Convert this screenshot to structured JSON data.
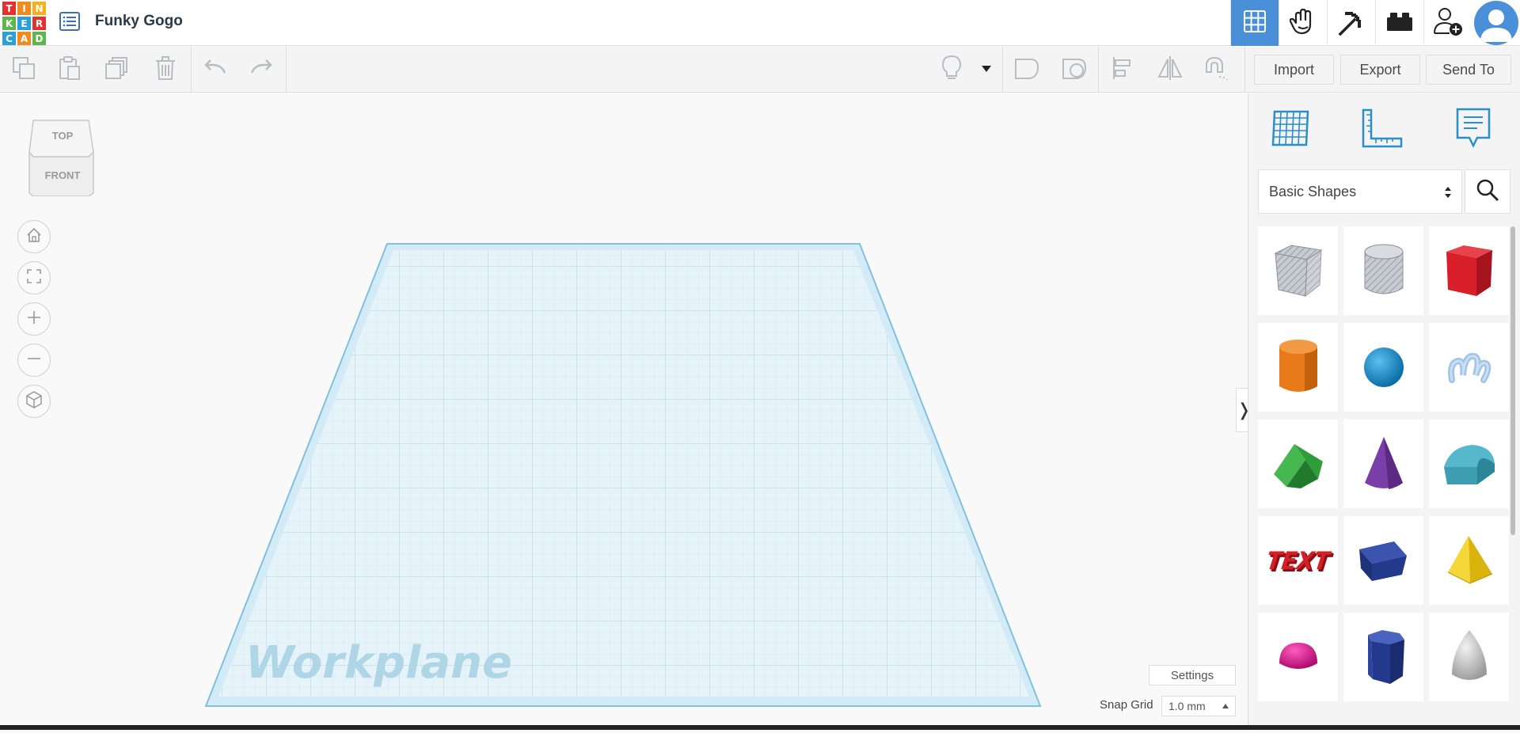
{
  "app": {
    "logo_letters": [
      "T",
      "I",
      "N",
      "K",
      "E",
      "R",
      "C",
      "A",
      "D"
    ],
    "logo_colors": [
      "#e4312b",
      "#f18b21",
      "#f6b019",
      "#5eb74d",
      "#2a9fd8",
      "#e4312b",
      "#2a9fd8",
      "#f18b21",
      "#5eb74d"
    ],
    "document_title": "Funky Gogo"
  },
  "topbar": {
    "buttons": [
      {
        "name": "3d-design-view",
        "icon": "grid-icon",
        "active": true
      },
      {
        "name": "codeblocks",
        "icon": "hand-icon",
        "active": false
      },
      {
        "name": "minecraft",
        "icon": "pickaxe-icon",
        "active": false
      },
      {
        "name": "lego-bricks",
        "icon": "brick-icon",
        "active": false
      },
      {
        "name": "invite",
        "icon": "add-user-icon",
        "active": false
      }
    ]
  },
  "toolbar": {
    "import_label": "Import",
    "export_label": "Export",
    "send_to_label": "Send To"
  },
  "viewcube": {
    "top_label": "TOP",
    "front_label": "FRONT"
  },
  "workplane": {
    "label": "Workplane"
  },
  "bottom": {
    "settings_label": "Settings",
    "snap_grid_label": "Snap Grid",
    "snap_grid_value": "1.0 mm"
  },
  "panel": {
    "library_selected": "Basic Shapes",
    "shapes": [
      {
        "name": "box-hole",
        "color": "#b8bcc4"
      },
      {
        "name": "cylinder-hole",
        "color": "#b8bcc4"
      },
      {
        "name": "box",
        "color": "#d81f2a"
      },
      {
        "name": "cylinder",
        "color": "#e87a1a"
      },
      {
        "name": "sphere",
        "color": "#1a8fd0"
      },
      {
        "name": "scribble",
        "color": "#9fc4e6"
      },
      {
        "name": "roof",
        "color": "#2f9e3a"
      },
      {
        "name": "cone",
        "color": "#7a3ea8"
      },
      {
        "name": "round-roof",
        "color": "#57b8cc"
      },
      {
        "name": "text",
        "color": "#d61e26"
      },
      {
        "name": "wedge",
        "color": "#233a8c"
      },
      {
        "name": "pyramid",
        "color": "#f2cc1a"
      },
      {
        "name": "half-sphere",
        "color": "#e01590"
      },
      {
        "name": "polygon",
        "color": "#233a8c"
      },
      {
        "name": "paraboloid",
        "color": "#c8c8c8"
      }
    ],
    "text_shape_label": "TEXT"
  },
  "colors": {
    "accent": "#4a90d9",
    "workplane_fill": "#e3f1f8",
    "workplane_border": "#8fc9e3"
  }
}
